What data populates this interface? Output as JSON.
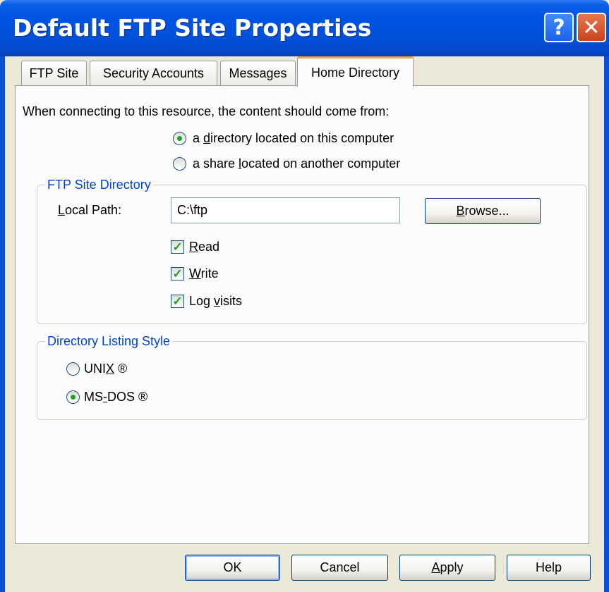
{
  "window": {
    "title": "Default FTP Site Properties",
    "help_glyph": "?",
    "close_glyph": "✕"
  },
  "tabs": [
    {
      "label": "FTP Site"
    },
    {
      "label": "Security Accounts"
    },
    {
      "label": "Messages"
    },
    {
      "label": "Home Directory",
      "active": true
    }
  ],
  "content_source": {
    "prompt": "When connecting to this resource, the content should come from:",
    "options": [
      {
        "pre": "a ",
        "key": "d",
        "post": "irectory located on this computer",
        "selected": true
      },
      {
        "pre": "a share ",
        "key": "l",
        "post": "ocated on another computer",
        "selected": false
      }
    ]
  },
  "ftp_site_directory": {
    "legend": "FTP Site Directory",
    "local_path_label": {
      "pre": "",
      "key": "L",
      "post": "ocal Path:"
    },
    "local_path_value": "C:\\ftp",
    "browse_label": {
      "pre": "",
      "key": "B",
      "post": "rowse..."
    },
    "permissions": [
      {
        "pre": "",
        "key": "R",
        "post": "ead",
        "checked": true
      },
      {
        "pre": "",
        "key": "W",
        "post": "rite",
        "checked": true
      },
      {
        "pre": "Log ",
        "key": "v",
        "post": "isits",
        "checked": true
      }
    ]
  },
  "listing_style": {
    "legend": "Directory Listing Style",
    "options": [
      {
        "pre": "UNI",
        "key": "X",
        "post": " ®",
        "selected": false
      },
      {
        "pre": "MS",
        "key": "-",
        "post": "DOS ®",
        "selected": true
      }
    ]
  },
  "buttons": {
    "ok": "OK",
    "cancel": "Cancel",
    "apply": {
      "pre": "",
      "key": "A",
      "post": "pply"
    },
    "help": "Help"
  },
  "colors": {
    "titlebar": "#0054e3",
    "tab_highlight": "#f5a33b",
    "group_legend": "#0046d5",
    "check_mark": "#21a121"
  }
}
